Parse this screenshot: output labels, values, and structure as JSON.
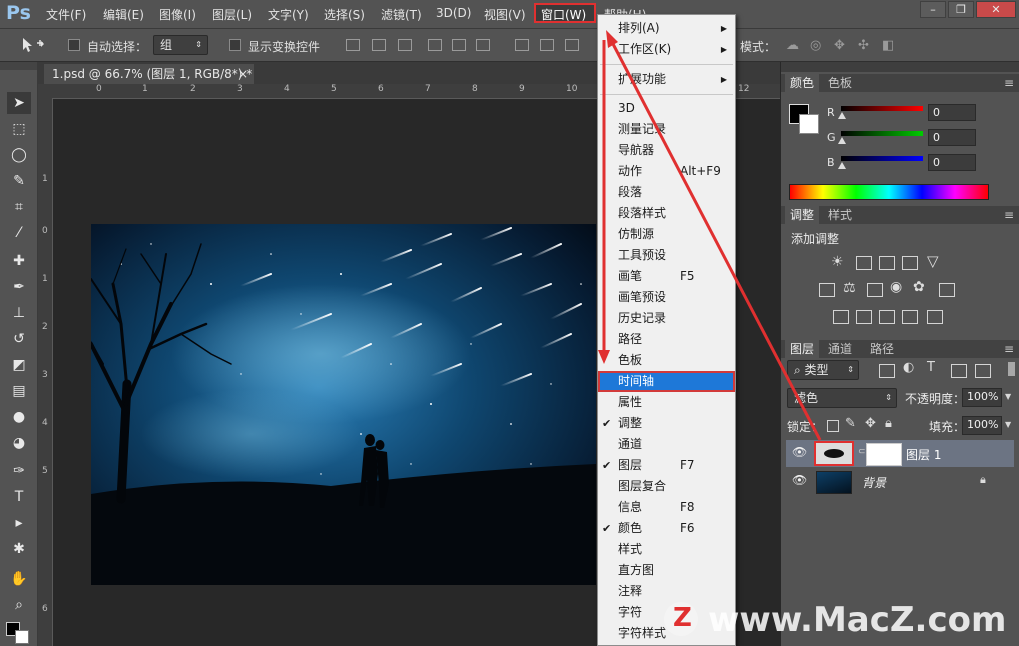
{
  "app": {
    "logo": "Ps"
  },
  "menubar": {
    "items": [
      "文件(F)",
      "编辑(E)",
      "图像(I)",
      "图层(L)",
      "文字(Y)",
      "选择(S)",
      "滤镜(T)",
      "3D(D)",
      "视图(V)",
      "窗口(W)",
      "帮助(H)"
    ],
    "window_controls": {
      "minimize": "–",
      "restore": "❐",
      "close": "✕"
    }
  },
  "optbar": {
    "auto_select_label": "自动选择：",
    "auto_select_value": "组",
    "show_transform_label": "显示变换控件",
    "mode_label": "模式："
  },
  "document": {
    "tab_label": "1.psd @ 66.7% (图层 1, RGB/8*) *",
    "close": "×",
    "ruler_top": [
      "0",
      "1",
      "2",
      "3",
      "4",
      "5",
      "6",
      "7",
      "8",
      "9",
      "10",
      "11",
      "12"
    ],
    "ruler_left": [
      "1",
      "0",
      "1",
      "2",
      "3",
      "4",
      "5",
      "6"
    ]
  },
  "window_menu": {
    "items": [
      {
        "label": "排列(A)",
        "arrow": true
      },
      {
        "label": "工作区(K)",
        "arrow": true
      },
      {
        "label": "扩展功能",
        "arrow": true
      },
      {
        "label": "3D"
      },
      {
        "label": "测量记录"
      },
      {
        "label": "导航器"
      },
      {
        "label": "动作",
        "shortcut": "Alt+F9"
      },
      {
        "label": "段落"
      },
      {
        "label": "段落样式"
      },
      {
        "label": "仿制源"
      },
      {
        "label": "工具预设"
      },
      {
        "label": "画笔",
        "shortcut": "F5"
      },
      {
        "label": "画笔预设"
      },
      {
        "label": "历史记录"
      },
      {
        "label": "路径"
      },
      {
        "label": "色板"
      },
      {
        "label": "时间轴",
        "highlighted": true
      },
      {
        "label": "属性"
      },
      {
        "label": "调整",
        "checked": true
      },
      {
        "label": "通道"
      },
      {
        "label": "图层",
        "shortcut": "F7",
        "checked": true
      },
      {
        "label": "图层复合"
      },
      {
        "label": "信息",
        "shortcut": "F8"
      },
      {
        "label": "颜色",
        "shortcut": "F6",
        "checked": true
      },
      {
        "label": "样式"
      },
      {
        "label": "直方图"
      },
      {
        "label": "注释"
      },
      {
        "label": "字符"
      },
      {
        "label": "字符样式"
      }
    ],
    "check_glyph": "✔",
    "arrow_glyph": "▶"
  },
  "color_panel": {
    "tabs": [
      "颜色",
      "色板"
    ],
    "r_label": "R",
    "g_label": "G",
    "b_label": "B",
    "r_value": "0",
    "g_value": "0",
    "b_value": "0"
  },
  "adjust_panel": {
    "tabs": [
      "调整",
      "样式"
    ],
    "title": "添加调整"
  },
  "layers_panel": {
    "tabs": [
      "图层",
      "通道",
      "路径"
    ],
    "filter_value": "类型",
    "blend_mode": "滤色",
    "opacity_label": "不透明度：",
    "opacity_value": "100%",
    "lock_label": "锁定：",
    "fill_label": "填充：",
    "fill_value": "100%",
    "layers": [
      {
        "name": "图层 1",
        "selected": true
      },
      {
        "name": "背景",
        "locked": true
      }
    ]
  },
  "watermark": {
    "logo_letter": "Z",
    "text": "www.MacZ.com"
  },
  "colors": {
    "accent_red": "#e03030",
    "menu_highlight": "#1e78d8",
    "panel_bg": "#535353"
  }
}
